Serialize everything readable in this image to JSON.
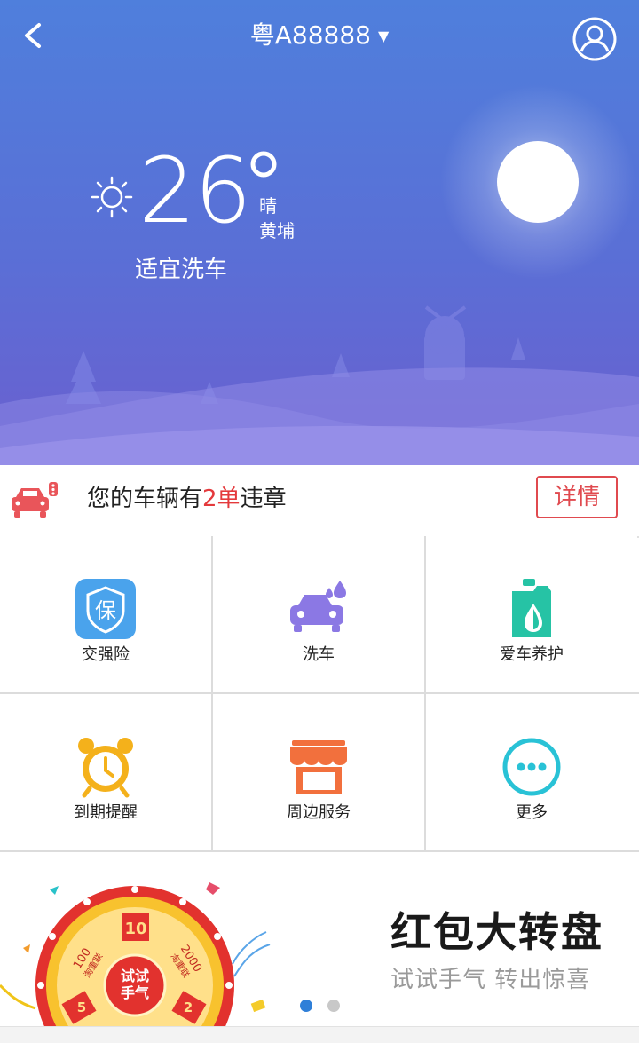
{
  "header": {
    "plate": "粤A88888",
    "plate_dropdown_icon": "caret-down-icon",
    "back_icon": "chevron-left-icon",
    "profile_icon": "user-circle-icon"
  },
  "weather": {
    "temperature": "26",
    "degree_symbol": "°",
    "condition": "晴",
    "city": "黄埔",
    "wash_advice": "适宜洗车",
    "icon": "sun-icon"
  },
  "violation": {
    "text_before": "您的车辆有",
    "count": "2单",
    "text_after": "违章",
    "detail_button": "详情",
    "icon": "car-violation-icon"
  },
  "services": [
    {
      "label": "交强险",
      "icon": "insurance-shield-icon"
    },
    {
      "label": "洗车",
      "icon": "car-wash-icon"
    },
    {
      "label": "爱车养护",
      "icon": "oil-bottle-icon"
    },
    {
      "label": "到期提醒",
      "icon": "alarm-clock-icon"
    },
    {
      "label": "周边服务",
      "icon": "store-icon"
    },
    {
      "label": "更多",
      "icon": "more-dots-icon"
    }
  ],
  "banner": {
    "title": "红包大转盘",
    "subtitle": "试试手气 转出惊喜",
    "wheel_center": "试试手气",
    "wheel_segments": [
      "10",
      "100",
      "2000",
      "5",
      "2"
    ],
    "wheel_segment_unit": "淘重联",
    "page_indicator": {
      "total": 2,
      "active": 1
    }
  },
  "colors": {
    "accent_red": "#e04a4f",
    "dot_active": "#2f7fd8",
    "dot_inactive": "#c8c8c8"
  }
}
